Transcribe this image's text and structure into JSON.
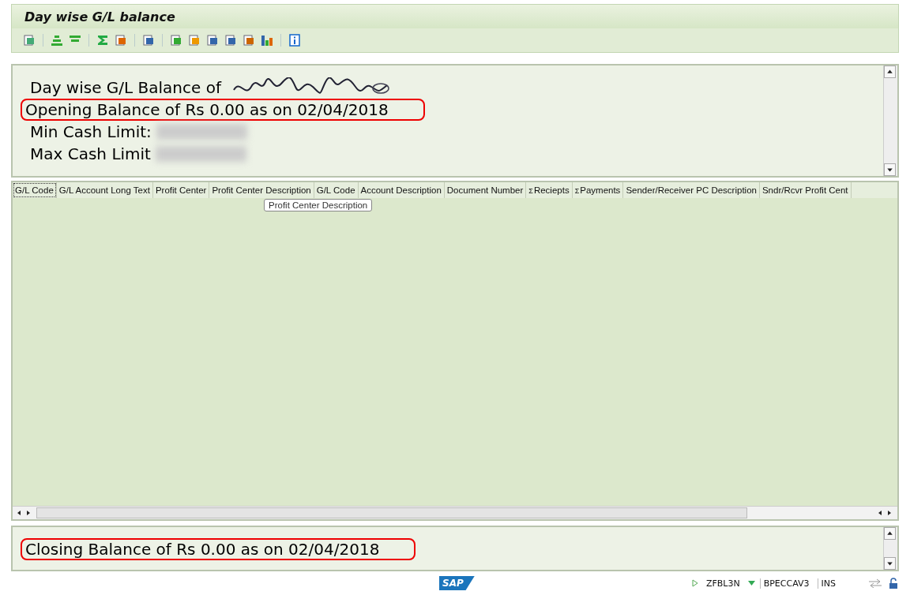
{
  "window": {
    "title": "Day wise G/L balance"
  },
  "header_panel": {
    "lines": [
      {
        "text": "Day wise G/L Balance of",
        "kind": "scribbled",
        "highlighted": false
      },
      {
        "text": "Opening Balance of Rs 0.00 as on 02/04/2018",
        "kind": "plain",
        "highlighted": true
      },
      {
        "text": "Min Cash Limit:",
        "kind": "blurred",
        "highlighted": false
      },
      {
        "text": "Max Cash Limit",
        "kind": "blurred",
        "highlighted": false
      }
    ]
  },
  "table": {
    "columns": [
      {
        "label": "G/L Code",
        "selected": true
      },
      {
        "label": "G/L Account Long Text",
        "selected": false
      },
      {
        "label": "Profit Center",
        "selected": false
      },
      {
        "label": "Profit Center Description",
        "selected": false
      },
      {
        "label": "G/L Code",
        "selected": false
      },
      {
        "label": "Account Description",
        "selected": false
      },
      {
        "label": "Document Number",
        "selected": false
      },
      {
        "label": "Reciepts",
        "total_mark": "Σ",
        "selected": false
      },
      {
        "label": "Payments",
        "total_mark": "Σ",
        "selected": false
      },
      {
        "label": "Sender/Receiver PC Description",
        "selected": false
      },
      {
        "label": "Sndr/Rcvr Profit Cent",
        "selected": false
      }
    ],
    "tooltip": "Profit Center Description"
  },
  "footer_panel": {
    "lines": [
      {
        "text": "Closing Balance of Rs 0.00 as on 02/04/2018",
        "highlighted": true
      }
    ]
  },
  "status_bar": {
    "logo": "SAP",
    "transaction": "ZFBL3N",
    "server": "BPECCAV3",
    "mode": "INS"
  }
}
